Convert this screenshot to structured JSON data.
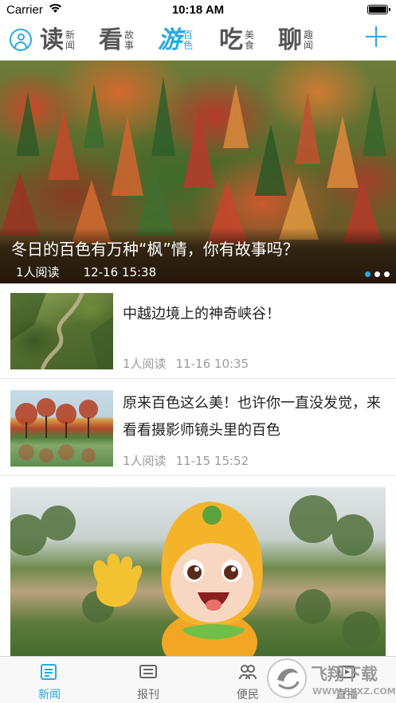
{
  "status_bar": {
    "carrier": "Carrier",
    "time": "10:18 AM"
  },
  "top_nav": {
    "tabs": [
      {
        "big": "读",
        "small_1": "新",
        "small_2": "闻",
        "active": false
      },
      {
        "big": "看",
        "small_1": "故",
        "small_2": "事",
        "active": false
      },
      {
        "big": "游",
        "small_1": "百",
        "small_2": "色",
        "active": true
      },
      {
        "big": "吃",
        "small_1": "美",
        "small_2": "食",
        "active": false
      },
      {
        "big": "聊",
        "small_1": "趣",
        "small_2": "闻",
        "active": false
      }
    ],
    "accent_color": "#28a9e2"
  },
  "hero": {
    "title": "冬日的百色有万种“枫”情，你有故事吗？",
    "reads": "1人阅读",
    "date": "12-16 15:38",
    "page_count": 3,
    "current_page": 1
  },
  "articles": [
    {
      "title": "中越边境上的神奇峡谷！",
      "reads": "1人阅读",
      "date": "11-16 10:35"
    },
    {
      "title": "原来百色这么美！也许你一直没发觉，来看看摄影师镜头里的百色",
      "reads": "1人阅读",
      "date": "11-15 15:52"
    }
  ],
  "tab_bar": {
    "items": [
      {
        "label": "新闻",
        "icon": "news-icon",
        "active": true
      },
      {
        "label": "报刊",
        "icon": "newspaper-icon",
        "active": false
      },
      {
        "label": "便民",
        "icon": "people-icon",
        "active": false
      },
      {
        "label": "直播",
        "icon": "live-icon",
        "active": false
      }
    ]
  },
  "watermark": {
    "text": "飞翔下载",
    "url": "WWW.FXXZ.COM"
  }
}
